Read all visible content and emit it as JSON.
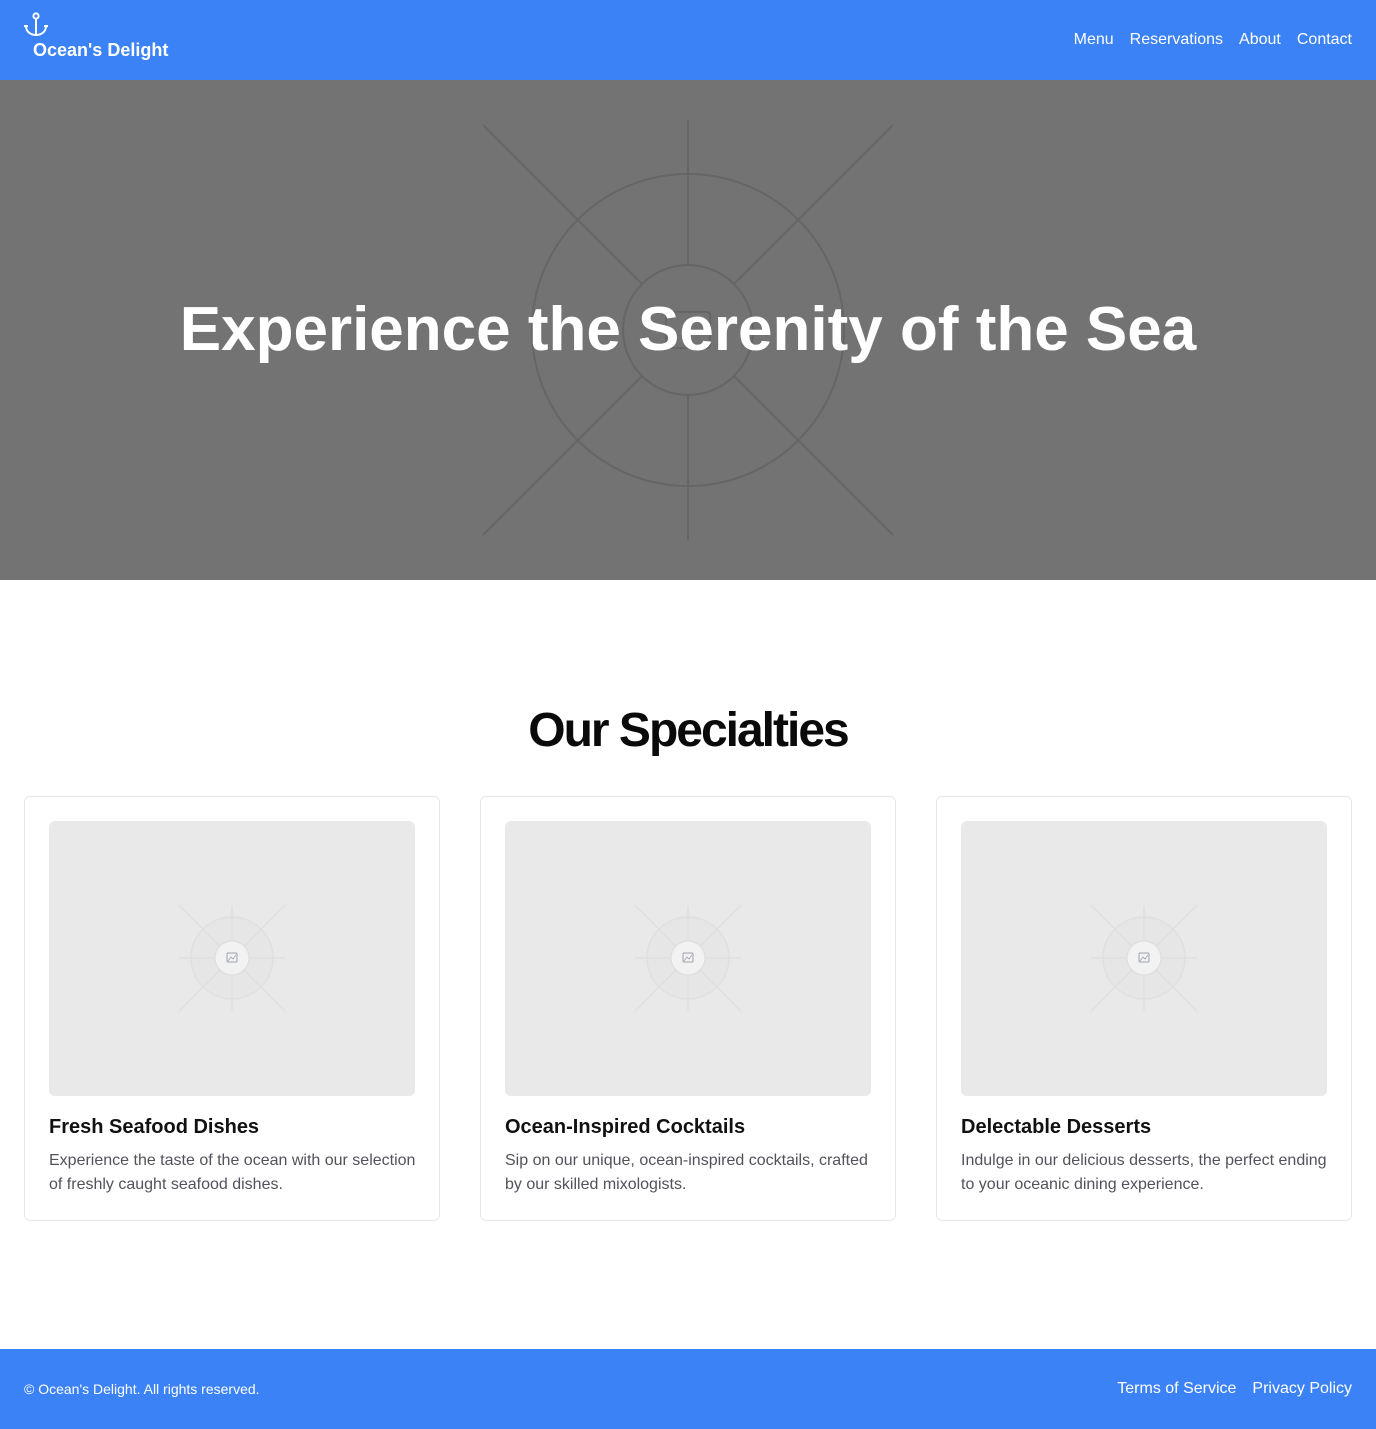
{
  "header": {
    "brand_name": "Ocean's Delight",
    "logo_icon": "anchor-icon",
    "nav": [
      "Menu",
      "Reservations",
      "About",
      "Contact"
    ]
  },
  "hero": {
    "title": "Experience the Serenity of the Sea",
    "background_icon": "image-placeholder-icon"
  },
  "specialties": {
    "title": "Our Specialties",
    "cards": [
      {
        "title": "Fresh Seafood Dishes",
        "description": "Experience the taste of the ocean with our selection of freshly caught seafood dishes.",
        "image_icon": "image-placeholder-icon"
      },
      {
        "title": "Ocean-Inspired Cocktails",
        "description": "Sip on our unique, ocean-inspired cocktails, crafted by our skilled mixologists.",
        "image_icon": "image-placeholder-icon"
      },
      {
        "title": "Delectable Desserts",
        "description": "Indulge in our delicious desserts, the perfect ending to your oceanic dining experience.",
        "image_icon": "image-placeholder-icon"
      }
    ]
  },
  "footer": {
    "copyright": "© Ocean's Delight. All rights reserved.",
    "links": [
      "Terms of Service",
      "Privacy Policy"
    ]
  },
  "colors": {
    "primary": "#3b82f6",
    "hero_bg": "#737373",
    "placeholder_bg": "#e9e9e9",
    "text_muted": "#52525b"
  }
}
